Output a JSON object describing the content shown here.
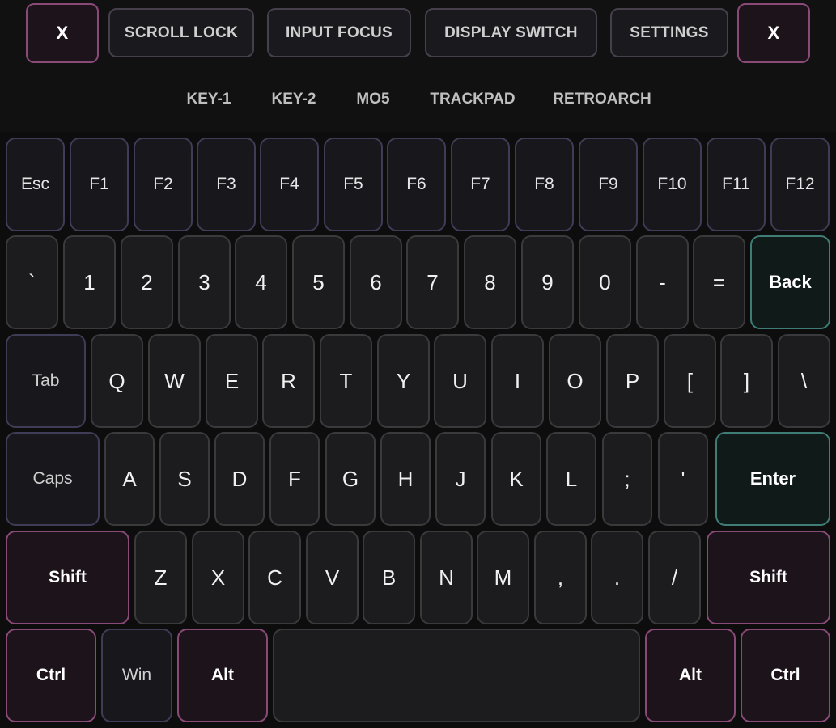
{
  "toolbar": {
    "close_left": "X",
    "scroll_lock": "SCROLL LOCK",
    "input_focus": "INPUT FOCUS",
    "display_switch": "DISPLAY SWITCH",
    "settings": "SETTINGS",
    "close_right": "X"
  },
  "tabs": [
    "KEY-1",
    "KEY-2",
    "MO5",
    "TRACKPAD",
    "RETROARCH"
  ],
  "keyboard": {
    "function_row": [
      "Esc",
      "F1",
      "F2",
      "F3",
      "F4",
      "F5",
      "F6",
      "F7",
      "F8",
      "F9",
      "F10",
      "F11",
      "F12"
    ],
    "number_row": [
      "`",
      "1",
      "2",
      "3",
      "4",
      "5",
      "6",
      "7",
      "8",
      "9",
      "0",
      "-",
      "=",
      "Back"
    ],
    "qwerty_row": [
      "Tab",
      "Q",
      "W",
      "E",
      "R",
      "T",
      "Y",
      "U",
      "I",
      "O",
      "P",
      "[",
      "]",
      "\\"
    ],
    "home_row": [
      "Caps",
      "A",
      "S",
      "D",
      "F",
      "G",
      "H",
      "J",
      "K",
      "L",
      ";",
      "'",
      "Enter"
    ],
    "shift_row": [
      "Shift",
      "Z",
      "X",
      "C",
      "V",
      "B",
      "N",
      "M",
      ",",
      ".",
      "/",
      "Shift"
    ],
    "bottom_row": [
      "Ctrl",
      "Win",
      "Alt",
      "",
      "Alt",
      "Ctrl"
    ]
  },
  "colors": {
    "modifier_border": "#8a4a78",
    "enter_back_border": "#3f7c76",
    "key_background": "#1c1c1e"
  }
}
